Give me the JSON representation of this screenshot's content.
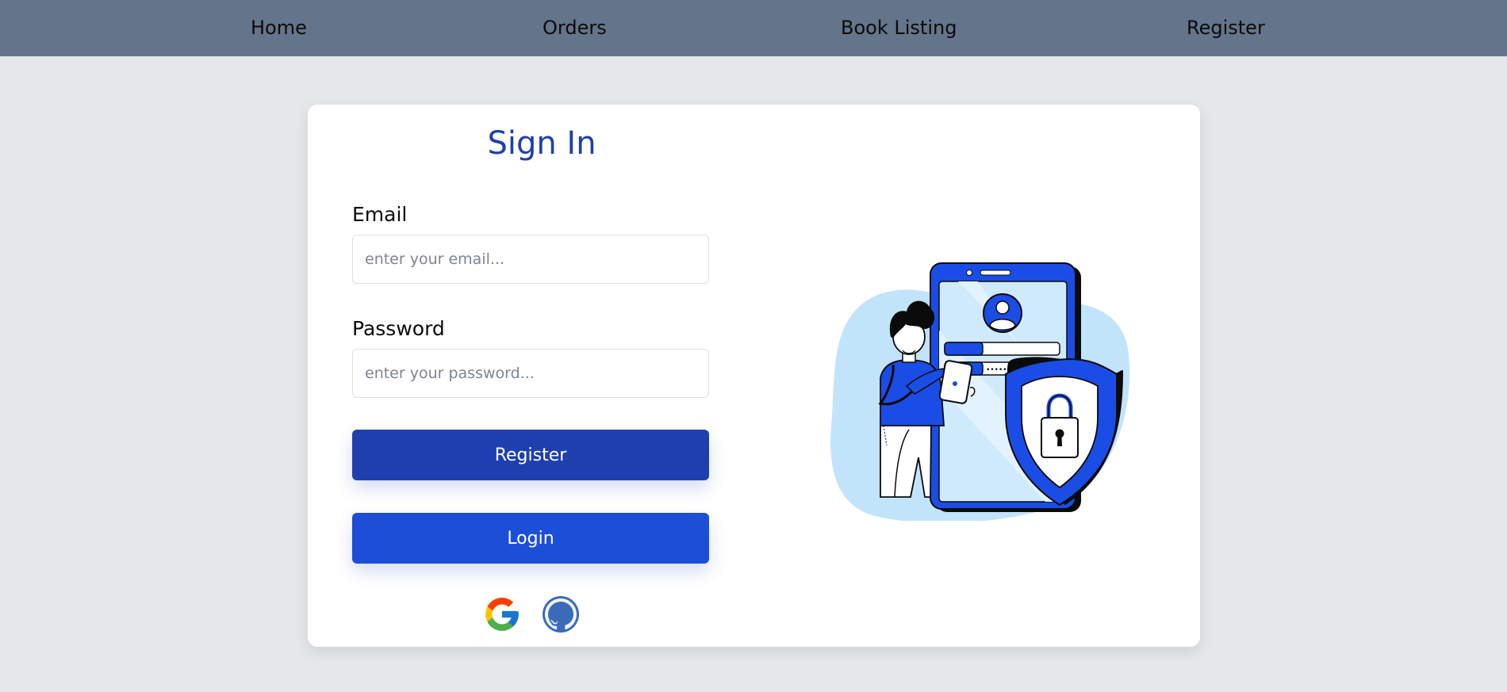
{
  "nav": {
    "items": [
      {
        "label": "Home"
      },
      {
        "label": "Orders"
      },
      {
        "label": "Book Listing"
      },
      {
        "label": "Register"
      }
    ]
  },
  "signin": {
    "title": "Sign In",
    "email_label": "Email",
    "email_placeholder": "enter your email...",
    "email_value": "",
    "password_label": "Password",
    "password_placeholder": "enter your password...",
    "password_value": "",
    "register_button": "Register",
    "login_button": "Login"
  },
  "social": [
    {
      "icon": "google-icon"
    },
    {
      "icon": "github-icon"
    }
  ],
  "illustration": {
    "icon": "security-login-illustration",
    "password_mask": "•••••••••••••••"
  },
  "colors": {
    "navbar": "#64748b",
    "page_background": "#e5e7eb",
    "accent": "#1e40af",
    "register_button": "#1e40af",
    "login_button": "#1d4ed8"
  }
}
